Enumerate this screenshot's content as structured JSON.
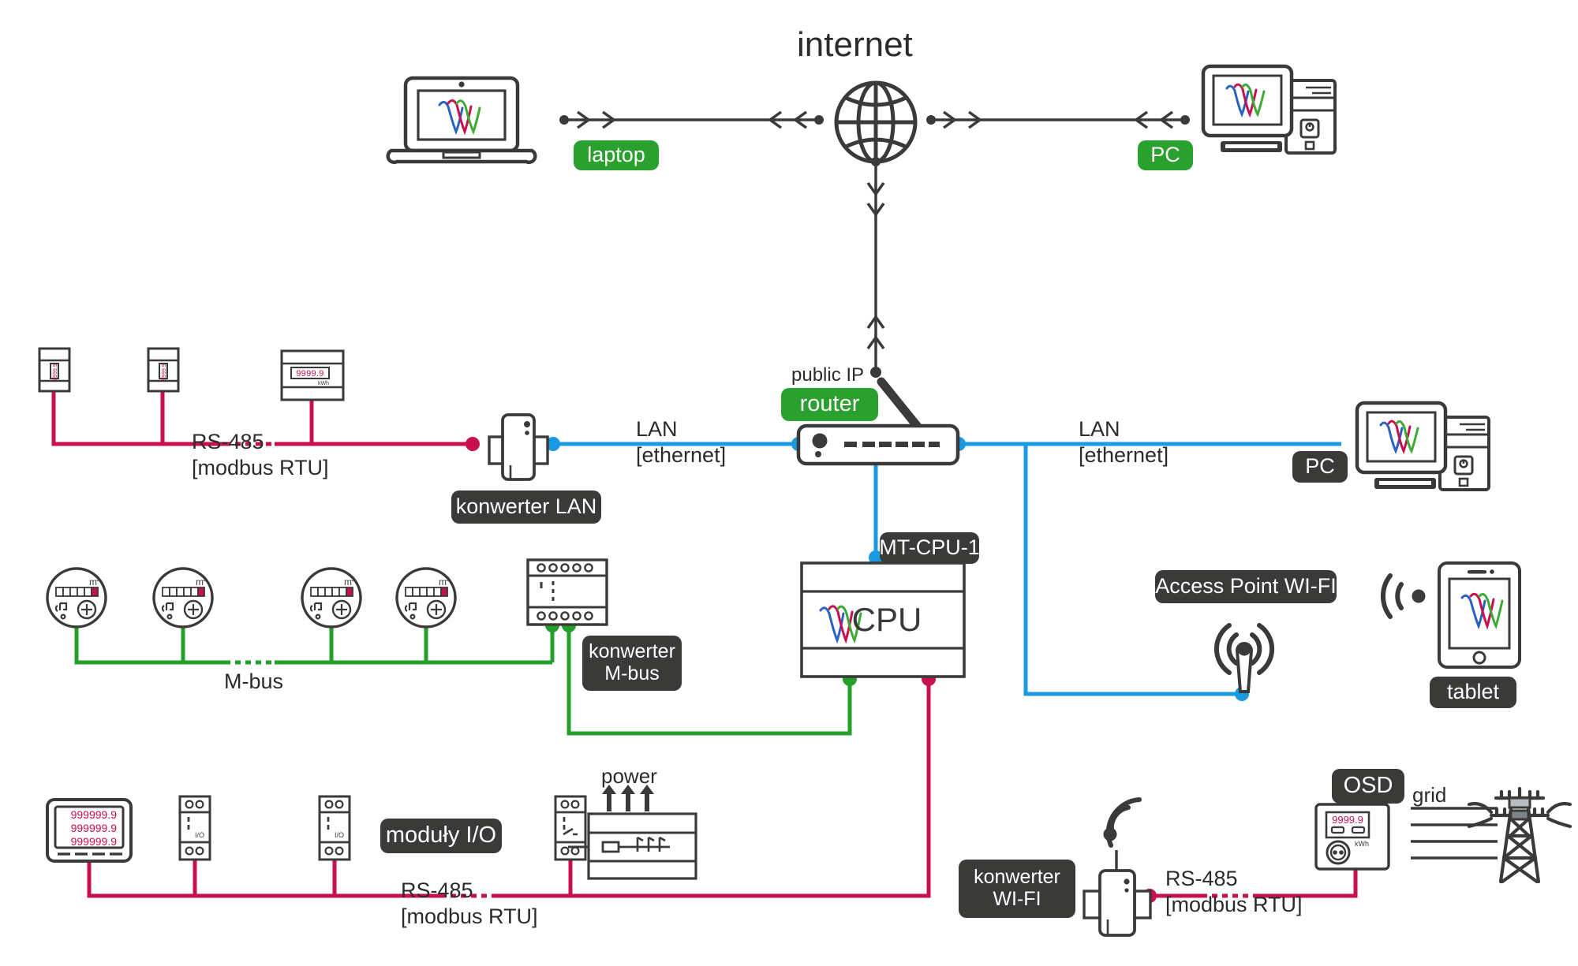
{
  "diagram": {
    "title": "internet",
    "colors": {
      "green_badge": "#2aa12f",
      "dark_badge": "#3a3a38",
      "lan_blue": "#1a9ae0",
      "rs485_crimson": "#c8104e",
      "mbus_green": "#22a02a",
      "outline": "#3a3a38",
      "logo_blue": "#2a62c4",
      "logo_red": "#c8104e",
      "logo_green": "#3faa35",
      "lcd_red": "#c8104e",
      "background": "#ffffff"
    },
    "badges": {
      "laptop": "laptop",
      "pc_top": "PC",
      "router": "router",
      "konwerter_lan": "konwerter LAN",
      "konwerter_mbus": "konwerter\nM-bus",
      "mt_cpu_1": "MT-CPU-1",
      "access_point": "Access Point WI-FI",
      "tablet": "tablet",
      "pc_right": "PC",
      "moduly_io": "moduły I/O",
      "konwerter_wifi": "konwerter\nWI-FI",
      "osd": "OSD"
    },
    "labels": {
      "public_ip": "public IP",
      "lan_left": "LAN\n[ethernet]",
      "lan_right": "LAN\n[ethernet]",
      "rs485_top": "RS-485\n[modbus RTU]",
      "rs485_bottom": "RS-485\n[modbus RTU]",
      "rs485_wifi": "RS-485\n[modbus RTU]",
      "mbus": "M-bus",
      "power": "power",
      "grid": "grid",
      "cpu": "CPU",
      "io_module": "I/O",
      "kwh": "kWh",
      "m3": "m",
      "m3_sup": "3"
    },
    "readouts": {
      "energy_meter_top": "9999.9",
      "energy_meter_top_unit": "kWh",
      "osd_meter": "9999.9",
      "osd_meter_unit": "kWh",
      "display_panel_lines": [
        "999999.9",
        "999999.9",
        "999999.9"
      ],
      "din_meter_small": "9999.9"
    },
    "devices": [
      {
        "id": "laptop",
        "name": "laptop",
        "kind": "laptop",
        "badge": "laptop"
      },
      {
        "id": "globe",
        "name": "internet",
        "kind": "globe",
        "badge": "internet"
      },
      {
        "id": "pc-top",
        "name": "PC",
        "kind": "desktop-pc",
        "badge": "PC"
      },
      {
        "id": "router",
        "name": "router",
        "kind": "router",
        "badge": "router"
      },
      {
        "id": "konwerter-lan",
        "name": "konwerter LAN",
        "kind": "converter",
        "badge": "konwerter LAN"
      },
      {
        "id": "cpu",
        "name": "MT-CPU-1",
        "kind": "cpu-box",
        "badge": "MT-CPU-1"
      },
      {
        "id": "pc-right",
        "name": "PC",
        "kind": "desktop-pc",
        "badge": "PC"
      },
      {
        "id": "access-point",
        "name": "Access Point WI-FI",
        "kind": "antenna",
        "badge": "Access Point WI-FI"
      },
      {
        "id": "tablet",
        "name": "tablet",
        "kind": "tablet",
        "badge": "tablet"
      },
      {
        "id": "konwerter-mbus",
        "name": "konwerter M-bus",
        "kind": "din-module",
        "badge": "konwerter M-bus"
      },
      {
        "id": "konwerter-wifi",
        "name": "konwerter WI-FI",
        "kind": "wifi-converter",
        "badge": "konwerter WI-FI"
      },
      {
        "id": "osd-meter",
        "name": "OSD",
        "kind": "energy-meter",
        "badge": "OSD"
      },
      {
        "id": "pylon",
        "name": "grid",
        "kind": "transmission-tower",
        "badge": "grid"
      },
      {
        "id": "display-panel",
        "name": "display panel",
        "kind": "lcd-panel",
        "badge": ""
      },
      {
        "id": "io-modules",
        "name": "moduły I/O",
        "kind": "din-io",
        "badge": "moduły I/O"
      },
      {
        "id": "breaker",
        "name": "power",
        "kind": "breaker",
        "badge": "power"
      }
    ],
    "buses": [
      {
        "id": "rs485-top",
        "label": "RS-485 [modbus RTU]",
        "color": "#c8104e",
        "members": [
          "din-meter-1",
          "din-meter-2",
          "energy-meter-1",
          "konwerter-lan"
        ]
      },
      {
        "id": "mbus",
        "label": "M-bus",
        "color": "#22a02a",
        "members": [
          "water-meter-1",
          "water-meter-2",
          "water-meter-3",
          "water-meter-4",
          "konwerter-mbus"
        ]
      },
      {
        "id": "rs485-bottom",
        "label": "RS-485 [modbus RTU]",
        "color": "#c8104e",
        "members": [
          "display-panel",
          "io-module-1",
          "io-module-2",
          "io-module-3",
          "cpu"
        ]
      },
      {
        "id": "rs485-wifi",
        "label": "RS-485 [modbus RTU]",
        "color": "#c8104e",
        "members": [
          "konwerter-wifi",
          "osd-meter"
        ]
      },
      {
        "id": "lan",
        "label": "LAN [ethernet]",
        "color": "#1a9ae0",
        "members": [
          "konwerter-lan",
          "router",
          "cpu",
          "pc-right",
          "access-point"
        ]
      }
    ]
  }
}
